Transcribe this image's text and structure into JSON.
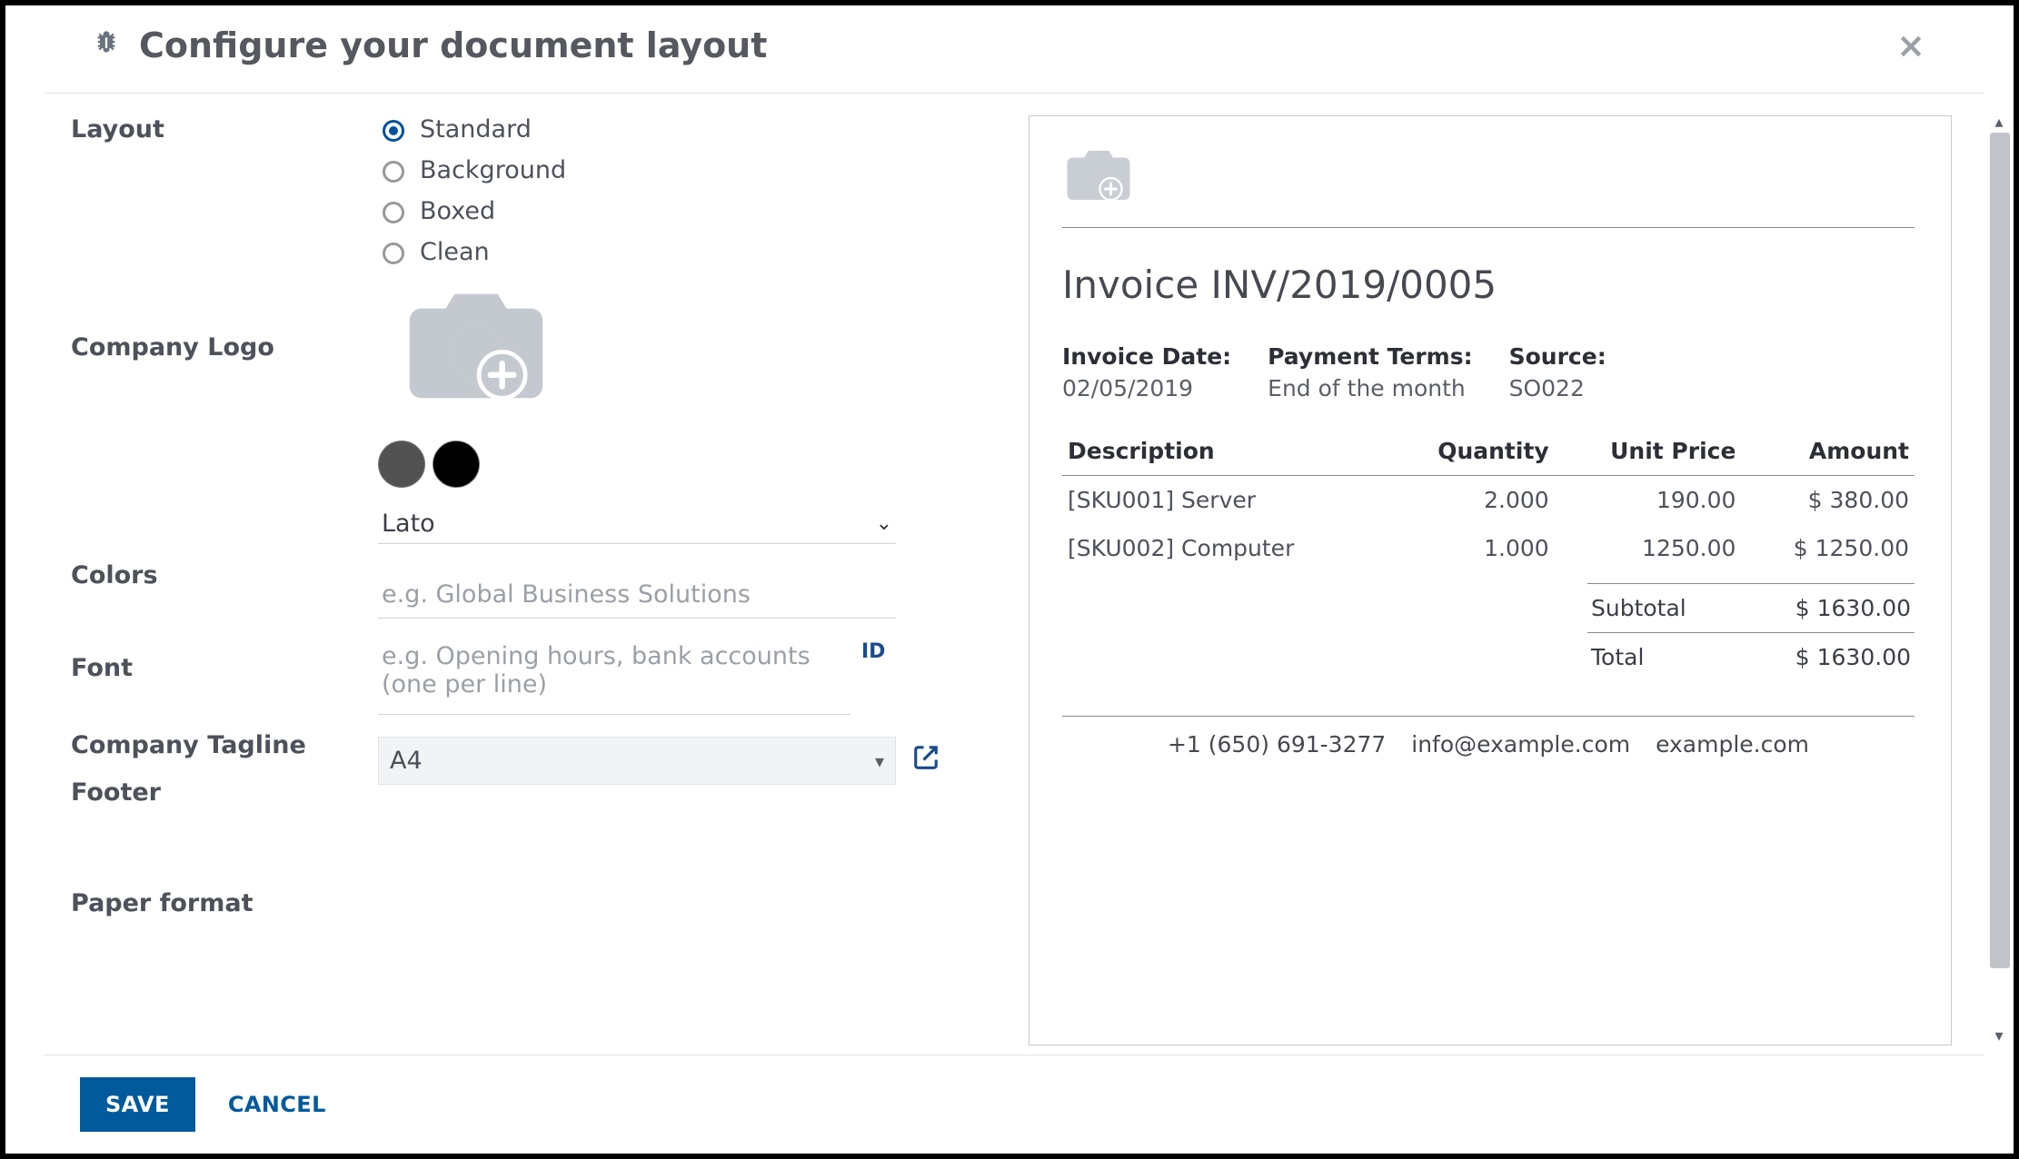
{
  "header": {
    "title": "Configure your document layout"
  },
  "form": {
    "labels": {
      "layout": "Layout",
      "logo": "Company Logo",
      "colors": "Colors",
      "font": "Font",
      "tagline": "Company Tagline",
      "footer": "Footer",
      "paper": "Paper format"
    },
    "layout_options": [
      "Standard",
      "Background",
      "Boxed",
      "Clean"
    ],
    "layout_selected": "Standard",
    "colors": {
      "primary": "#525252",
      "secondary": "#000000"
    },
    "font_value": "Lato",
    "tagline_placeholder": "e.g. Global Business Solutions",
    "tagline_value": "",
    "footer_placeholder": "e.g. Opening hours, bank accounts (one per line)",
    "footer_value": "",
    "footer_badge": "ID",
    "paper_value": "A4"
  },
  "preview": {
    "title": "Invoice INV/2019/0005",
    "meta": {
      "date_label": "Invoice Date:",
      "date_value": "02/05/2019",
      "terms_label": "Payment Terms:",
      "terms_value": "End of the month",
      "source_label": "Source:",
      "source_value": "SO022"
    },
    "columns": {
      "desc": "Description",
      "qty": "Quantity",
      "price": "Unit Price",
      "amount": "Amount"
    },
    "lines": [
      {
        "desc": "[SKU001] Server",
        "qty": "2.000",
        "price": "190.00",
        "amount": "$ 380.00"
      },
      {
        "desc": "[SKU002] Computer",
        "qty": "1.000",
        "price": "1250.00",
        "amount": "$ 1250.00"
      }
    ],
    "subtotal_label": "Subtotal",
    "subtotal_value": "$ 1630.00",
    "total_label": "Total",
    "total_value": "$ 1630.00",
    "footer": {
      "phone": "+1 (650) 691-3277",
      "email": "info@example.com",
      "site": "example.com"
    }
  },
  "actions": {
    "save": "SAVE",
    "cancel": "CANCEL"
  }
}
